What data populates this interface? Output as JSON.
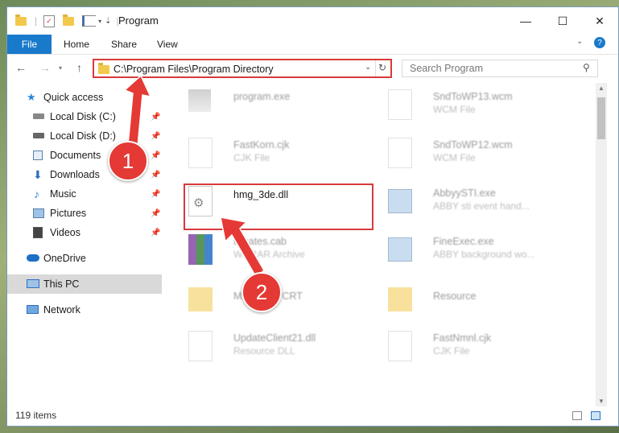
{
  "window": {
    "title": "Program",
    "minimize": "—",
    "maximize": "☐",
    "close": "✕"
  },
  "ribbon": {
    "file": "File",
    "home": "Home",
    "share": "Share",
    "view": "View",
    "help": "?"
  },
  "address": {
    "path": "C:\\Program Files\\Program Directory",
    "search_placeholder": "Search Program"
  },
  "sidebar": {
    "items": [
      {
        "label": "Quick access",
        "icon": "star-icon",
        "pinned": false
      },
      {
        "label": "Local Disk (C:)",
        "icon": "drive-icon",
        "pinned": true
      },
      {
        "label": "Local Disk (D:)",
        "icon": "drive-icon",
        "pinned": true
      },
      {
        "label": "Documents",
        "icon": "documents-icon",
        "pinned": true
      },
      {
        "label": "Downloads",
        "icon": "download-icon",
        "pinned": true
      },
      {
        "label": "Music",
        "icon": "music-icon",
        "pinned": true
      },
      {
        "label": "Pictures",
        "icon": "pictures-icon",
        "pinned": true
      },
      {
        "label": "Videos",
        "icon": "videos-icon",
        "pinned": true
      },
      {
        "label": "OneDrive",
        "icon": "cloud-icon",
        "pinned": false
      },
      {
        "label": "This PC",
        "icon": "computer-icon",
        "pinned": false
      },
      {
        "label": "Network",
        "icon": "network-icon",
        "pinned": false
      }
    ]
  },
  "files": [
    {
      "name": "program.exe",
      "type": ""
    },
    {
      "name": "SndToWP13.wcm",
      "type": "WCM File"
    },
    {
      "name": "FastKorn.cjk",
      "type": "CJK File"
    },
    {
      "name": "SndToWP12.wcm",
      "type": "WCM File"
    },
    {
      "name": "hmg_3de.dll",
      "type": ""
    },
    {
      "name": "AbbyySTI.exe",
      "type": "ABBY sti event hand..."
    },
    {
      "name": "tificates.cab",
      "type": "WinRAR Archive"
    },
    {
      "name": "FineExec.exe",
      "type": "ABBY background wo..."
    },
    {
      "name": "Micro C90 CRT",
      "type": ""
    },
    {
      "name": "Resource",
      "type": ""
    },
    {
      "name": "UpdateClient21.dll",
      "type": "Resource DLL"
    },
    {
      "name": "FastNmnl.cjk",
      "type": "CJK File"
    }
  ],
  "status": {
    "count": "119 items"
  },
  "callouts": {
    "one": "1",
    "two": "2"
  },
  "colors": {
    "accent": "#1979ca",
    "highlight": "#d93a3a",
    "badge": "#e53935"
  }
}
